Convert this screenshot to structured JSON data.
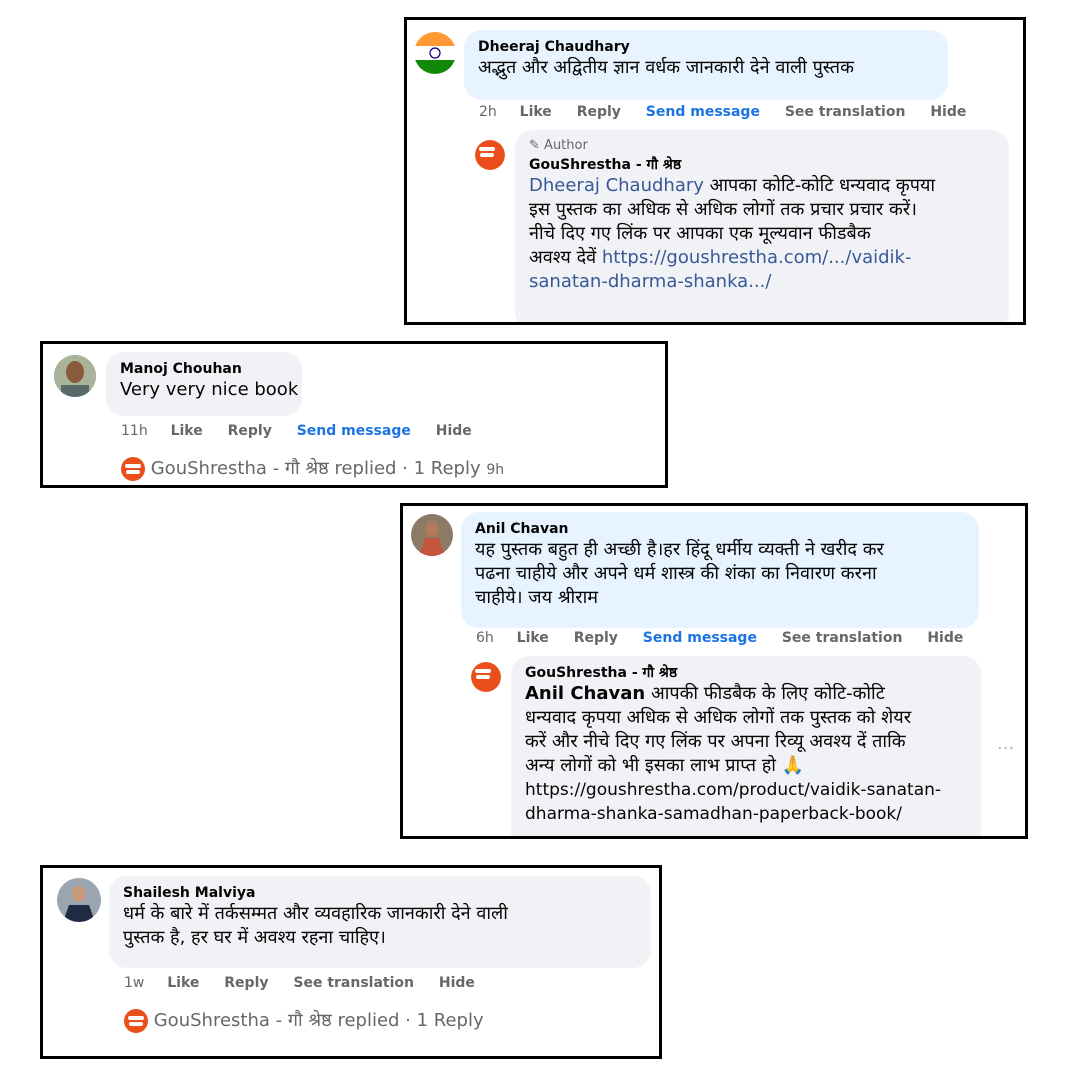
{
  "comments": [
    {
      "name": "Dheeraj Chaudhary",
      "text": "अद्भुत और अद्वितीय ज्ञान वर्धक जानकारी देने वाली पुस्तक",
      "time": "2h",
      "actions": [
        "Like",
        "Reply",
        "Send message",
        "See translation",
        "Hide"
      ],
      "reply": {
        "badge": "Author",
        "name": "GouShrestha - गौ श्रेष्ठ",
        "mention": "Dheeraj Chaudhary",
        "lines": [
          "आपका कोटि-कोटि धन्यवाद कृपया",
          "इस पुस्तक का अधिक से अधिक लोगों तक प्रचार प्रचार करें।",
          "नीचे दिए गए लिंक पर आपका एक मूल्यवान फीडबैक",
          "अवश्य देवें"
        ],
        "link_1": "https://goushrestha.com/.../vaidik-",
        "link_2": "sanatan-dharma-shanka.../"
      }
    },
    {
      "name": "Manoj Chouhan",
      "text": "Very very nice book",
      "time": "11h",
      "actions": [
        "Like",
        "Reply",
        "Send message",
        "Hide"
      ],
      "replied_by": "GouShrestha - गौ श्रेष्ठ",
      "replied_text": "replied · 1 Reply",
      "replied_time": "9h"
    },
    {
      "name": "Anil Chavan",
      "lines": [
        "यह पुस्तक बहुत ही अच्छी है।हर हिंदू धर्मीय व्यक्ती ने खरीद कर",
        "पढना चाहीये और अपने धर्म शास्त्र की शंका का निवारण करना",
        "चाहीये। जय श्रीराम"
      ],
      "time": "6h",
      "actions": [
        "Like",
        "Reply",
        "Send message",
        "See translation",
        "Hide"
      ],
      "reply": {
        "name": "GouShrestha - गौ श्रेष्ठ",
        "mention": "Anil Chavan",
        "lines": [
          "आपकी फीडबैक के लिए कोटि-कोटि",
          "धन्यवाद कृपया अधिक से अधिक लोगों तक पुस्तक को शेयर",
          "करें और नीचे दिए गए लिंक पर अपना रिव्यू अवश्य दें ताकि",
          "अन्य लोगों को भी इसका लाभ प्राप्त हो 🙏"
        ],
        "url_1": "https://goushrestha.com/product/vaidik-sanatan-",
        "url_2": "dharma-shanka-samadhan-paperback-book/",
        "more": "···"
      }
    },
    {
      "name": "Shailesh Malviya",
      "lines": [
        "धर्म के बारे में तर्कसम्मत और व्यवहारिक जानकारी देने वाली",
        "पुस्तक है, हर घर में अवश्य रहना चाहिए।"
      ],
      "time": "1w",
      "actions": [
        "Like",
        "Reply",
        "See translation",
        "Hide"
      ],
      "replied_by": "GouShrestha - गौ श्रेष्ठ",
      "replied_text": "replied · 1 Reply"
    }
  ],
  "colors": {
    "bubble": "#f0f2f5",
    "bubble_highlight": "#e7f3ff",
    "link": "#1b74e4",
    "meta": "#65676b",
    "brand": "#e94e1b"
  },
  "icons": [
    "india-flag-icon",
    "goushrestha-logo-icon",
    "pencil-icon",
    "folded-hands-emoji"
  ]
}
